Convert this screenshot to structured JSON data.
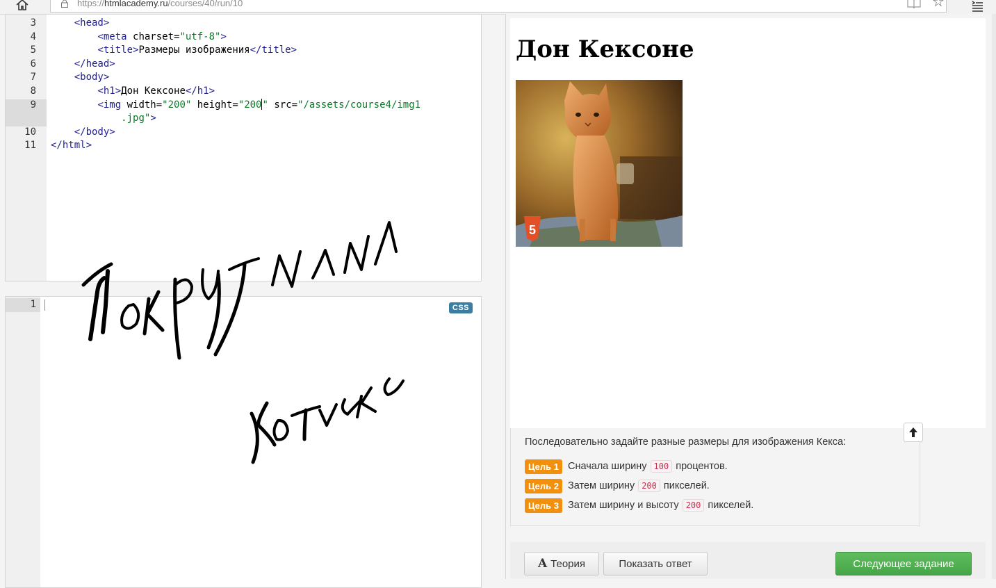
{
  "browser": {
    "url_prefix": "https://",
    "url_host": "htmlacademy.ru",
    "url_path": "/courses/40/run/10"
  },
  "html_editor": {
    "line_numbers": [
      "3",
      "4",
      "5",
      "6",
      "7",
      "8",
      "9",
      "",
      "10",
      "11"
    ],
    "lines": [
      {
        "indent": "    ",
        "parts": [
          [
            "tag",
            "<head>"
          ]
        ]
      },
      {
        "indent": "        ",
        "parts": [
          [
            "tag",
            "<meta "
          ],
          [
            "attr",
            "charset="
          ],
          [
            "str",
            "\"utf-8\""
          ],
          [
            "tag",
            ">"
          ]
        ]
      },
      {
        "indent": "        ",
        "parts": [
          [
            "tag",
            "<title>"
          ],
          [
            "attr",
            "Размеры изображения"
          ],
          [
            "tag",
            "</title>"
          ]
        ]
      },
      {
        "indent": "    ",
        "parts": [
          [
            "tag",
            "</head>"
          ]
        ]
      },
      {
        "indent": "    ",
        "parts": [
          [
            "tag",
            "<body>"
          ]
        ]
      },
      {
        "indent": "        ",
        "parts": [
          [
            "tag",
            "<h1>"
          ],
          [
            "attr",
            "Дон Кексоне"
          ],
          [
            "tag",
            "</h1>"
          ]
        ]
      },
      {
        "indent": "        ",
        "parts": [
          [
            "tag",
            "<img "
          ],
          [
            "attr",
            "width="
          ],
          [
            "str",
            "\"200\""
          ],
          [
            "attr",
            " height="
          ],
          [
            "str",
            "\"200"
          ],
          [
            "cursor",
            ""
          ],
          [
            "str",
            "\""
          ],
          [
            "attr",
            " src="
          ],
          [
            "str",
            "\"/assets/course4/img1"
          ]
        ]
      },
      {
        "indent": "            ",
        "parts": [
          [
            "str",
            ".jpg\""
          ],
          [
            "tag",
            ">"
          ]
        ]
      },
      {
        "indent": "    ",
        "parts": [
          [
            "tag",
            "</body>"
          ]
        ]
      },
      {
        "indent": "",
        "parts": [
          [
            "tag",
            "</html>"
          ]
        ]
      }
    ]
  },
  "css_editor": {
    "line_numbers": [
      "1"
    ],
    "badge": "CSS"
  },
  "handwriting": {
    "line1": "Покрутили",
    "line2": "Котика"
  },
  "preview": {
    "title": "Дон Кексоне"
  },
  "task": {
    "intro": "Последовательно задайте разные размеры для изображения Кекса:",
    "goals": [
      {
        "badge": "Цель 1",
        "before": "Сначала ширину",
        "code": "100",
        "after": "процентов."
      },
      {
        "badge": "Цель 2",
        "before": "Затем ширину",
        "code": "200",
        "after": "пикселей."
      },
      {
        "badge": "Цель 3",
        "before": "Затем ширину и высоту",
        "code": "200",
        "after": "пикселей."
      }
    ]
  },
  "buttons": {
    "theory": "Теория",
    "theory_icon": "A",
    "show_answer": "Показать ответ",
    "next_task": "Следующее задание"
  },
  "colors": {
    "goal_badge": "#f0900e",
    "next_button": "#4cae4c",
    "css_badge": "#3b7ea1"
  }
}
